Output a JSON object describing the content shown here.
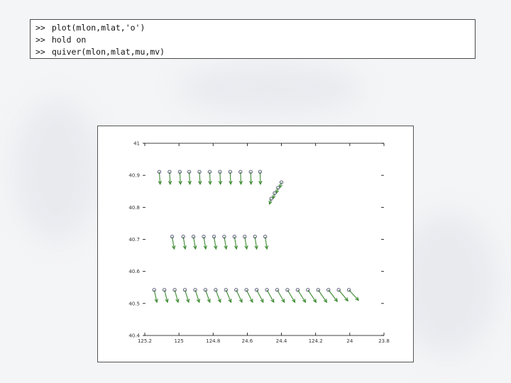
{
  "command_window": {
    "lines": [
      {
        "prompt": ">>",
        "command": "plot(mlon,mlat,'o')"
      },
      {
        "prompt": ">>",
        "command": "hold on"
      },
      {
        "prompt": ">>",
        "command": "quiver(mlon,mlat,mu,mv)"
      }
    ]
  },
  "colors": {
    "marker": "#4c4c6c",
    "arrow": "#3a8a2e",
    "axis": "#000000"
  },
  "chart_data": {
    "type": "scatter",
    "title": "",
    "xlabel": "",
    "ylabel": "",
    "xlim": [
      0,
      14
    ],
    "ylim": [
      0,
      7
    ],
    "x_tick_labels": [
      "125.2",
      "125",
      "124.8",
      "24.6",
      "24.4",
      "124.2",
      "24",
      "23.8"
    ],
    "y_tick_labels": [
      "41",
      "40.9",
      "40.8",
      "40.7",
      "40.6",
      "40.5",
      "40.4"
    ],
    "grid": false,
    "series": [
      {
        "points": [
          {
            "x": 0.85,
            "y": 5.96,
            "u": 0.05,
            "v": -0.45
          },
          {
            "x": 1.45,
            "y": 5.96,
            "u": 0.04,
            "v": -0.45
          },
          {
            "x": 2.05,
            "y": 5.96,
            "u": 0.04,
            "v": -0.45
          },
          {
            "x": 2.6,
            "y": 5.96,
            "u": 0.04,
            "v": -0.45
          },
          {
            "x": 3.2,
            "y": 5.96,
            "u": 0.04,
            "v": -0.45
          },
          {
            "x": 3.8,
            "y": 5.96,
            "u": 0.03,
            "v": -0.45
          },
          {
            "x": 4.4,
            "y": 5.96,
            "u": 0.03,
            "v": -0.45
          },
          {
            "x": 5.0,
            "y": 5.96,
            "u": 0.03,
            "v": -0.45
          },
          {
            "x": 5.6,
            "y": 5.96,
            "u": 0.03,
            "v": -0.45
          },
          {
            "x": 6.2,
            "y": 5.96,
            "u": 0.02,
            "v": -0.45
          },
          {
            "x": 6.75,
            "y": 5.96,
            "u": 0.02,
            "v": -0.45
          },
          {
            "x": 8.0,
            "y": 5.58,
            "u": -0.1,
            "v": -0.2
          },
          {
            "x": 7.8,
            "y": 5.38,
            "u": -0.1,
            "v": -0.2
          },
          {
            "x": 7.6,
            "y": 5.18,
            "u": -0.1,
            "v": -0.2
          },
          {
            "x": 7.4,
            "y": 4.98,
            "u": -0.1,
            "v": -0.2
          },
          {
            "x": 1.6,
            "y": 3.6,
            "u": 0.12,
            "v": -0.45
          },
          {
            "x": 2.25,
            "y": 3.6,
            "u": 0.12,
            "v": -0.45
          },
          {
            "x": 2.85,
            "y": 3.6,
            "u": 0.12,
            "v": -0.45
          },
          {
            "x": 3.45,
            "y": 3.6,
            "u": 0.12,
            "v": -0.45
          },
          {
            "x": 4.05,
            "y": 3.6,
            "u": 0.12,
            "v": -0.45
          },
          {
            "x": 4.65,
            "y": 3.6,
            "u": 0.12,
            "v": -0.45
          },
          {
            "x": 5.25,
            "y": 3.6,
            "u": 0.12,
            "v": -0.45
          },
          {
            "x": 5.85,
            "y": 3.6,
            "u": 0.12,
            "v": -0.45
          },
          {
            "x": 6.45,
            "y": 3.6,
            "u": 0.1,
            "v": -0.45
          },
          {
            "x": 7.05,
            "y": 3.6,
            "u": 0.1,
            "v": -0.45
          },
          {
            "x": 0.55,
            "y": 1.66,
            "u": 0.16,
            "v": -0.45
          },
          {
            "x": 1.15,
            "y": 1.66,
            "u": 0.18,
            "v": -0.45
          },
          {
            "x": 1.75,
            "y": 1.66,
            "u": 0.2,
            "v": -0.45
          },
          {
            "x": 2.35,
            "y": 1.66,
            "u": 0.22,
            "v": -0.45
          },
          {
            "x": 2.95,
            "y": 1.66,
            "u": 0.24,
            "v": -0.45
          },
          {
            "x": 3.55,
            "y": 1.66,
            "u": 0.26,
            "v": -0.45
          },
          {
            "x": 4.15,
            "y": 1.66,
            "u": 0.28,
            "v": -0.45
          },
          {
            "x": 4.75,
            "y": 1.66,
            "u": 0.3,
            "v": -0.45
          },
          {
            "x": 5.35,
            "y": 1.66,
            "u": 0.34,
            "v": -0.45
          },
          {
            "x": 5.95,
            "y": 1.66,
            "u": 0.36,
            "v": -0.45
          },
          {
            "x": 6.55,
            "y": 1.66,
            "u": 0.38,
            "v": -0.45
          },
          {
            "x": 7.15,
            "y": 1.66,
            "u": 0.4,
            "v": -0.45
          },
          {
            "x": 7.75,
            "y": 1.66,
            "u": 0.42,
            "v": -0.45
          },
          {
            "x": 8.35,
            "y": 1.66,
            "u": 0.44,
            "v": -0.45
          },
          {
            "x": 8.95,
            "y": 1.66,
            "u": 0.46,
            "v": -0.45
          },
          {
            "x": 9.55,
            "y": 1.66,
            "u": 0.48,
            "v": -0.45
          },
          {
            "x": 10.15,
            "y": 1.66,
            "u": 0.5,
            "v": -0.45
          },
          {
            "x": 10.75,
            "y": 1.66,
            "u": 0.52,
            "v": -0.42
          },
          {
            "x": 11.35,
            "y": 1.66,
            "u": 0.54,
            "v": -0.4
          },
          {
            "x": 11.95,
            "y": 1.66,
            "u": 0.56,
            "v": -0.38
          }
        ]
      }
    ]
  }
}
